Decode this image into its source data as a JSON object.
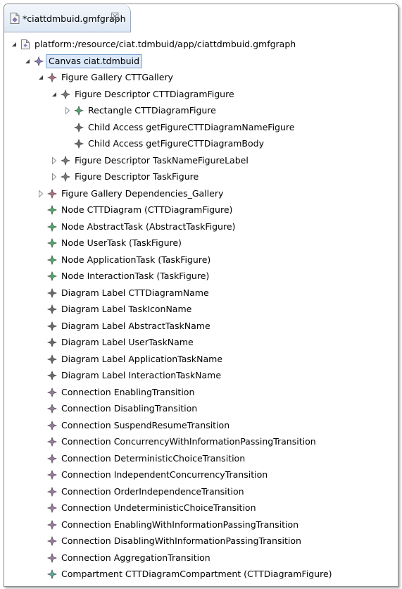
{
  "editor": {
    "tab_title": "*ciattdmbuid.gmfgraph",
    "tab_close_glyph": "☒"
  },
  "tree": {
    "rows": [
      {
        "label": "platform:/resource/ciat.tdmbuid/app/ciattdmbuid.gmfgraph",
        "depth": 0,
        "twisty": "expanded",
        "icon": "resource-file-icon",
        "color": "#7a7a7a"
      },
      {
        "label": "Canvas ciat.tdmbuid",
        "depth": 1,
        "twisty": "expanded",
        "icon": "canvas-icon",
        "color": "#8a7fb8",
        "selected": true
      },
      {
        "label": "Figure Gallery CTTGallery",
        "depth": 2,
        "twisty": "expanded",
        "icon": "figure-gallery-icon",
        "color": "#b0707e"
      },
      {
        "label": "Figure Descriptor CTTDiagramFigure",
        "depth": 3,
        "twisty": "expanded",
        "icon": "figure-descriptor-icon",
        "color": "#7a7a7a"
      },
      {
        "label": "Rectangle CTTDiagramFigure",
        "depth": 4,
        "twisty": "collapsed",
        "icon": "rectangle-icon",
        "color": "#4fa86a"
      },
      {
        "label": "Child Access getFigureCTTDiagramNameFigure",
        "depth": 4,
        "twisty": "none",
        "icon": "child-access-icon",
        "color": "#6a6a6a"
      },
      {
        "label": "Child Access getFigureCTTDiagramBody",
        "depth": 4,
        "twisty": "none",
        "icon": "child-access-icon",
        "color": "#6a6a6a"
      },
      {
        "label": "Figure Descriptor TaskNameFigureLabel",
        "depth": 3,
        "twisty": "collapsed",
        "icon": "figure-descriptor-icon",
        "color": "#7a7a7a"
      },
      {
        "label": "Figure Descriptor TaskFigure",
        "depth": 3,
        "twisty": "collapsed",
        "icon": "figure-descriptor-icon",
        "color": "#7a7a7a"
      },
      {
        "label": "Figure Gallery Dependencies_Gallery",
        "depth": 2,
        "twisty": "collapsed",
        "icon": "figure-gallery-icon",
        "color": "#b0707e"
      },
      {
        "label": "Node CTTDiagram (CTTDiagramFigure)",
        "depth": 2,
        "twisty": "none",
        "icon": "node-icon",
        "color": "#4fa86a"
      },
      {
        "label": "Node AbstractTask (AbstractTaskFigure)",
        "depth": 2,
        "twisty": "none",
        "icon": "node-icon",
        "color": "#4fa86a"
      },
      {
        "label": "Node UserTask (TaskFigure)",
        "depth": 2,
        "twisty": "none",
        "icon": "node-icon",
        "color": "#4fa86a"
      },
      {
        "label": "Node ApplicationTask (TaskFigure)",
        "depth": 2,
        "twisty": "none",
        "icon": "node-icon",
        "color": "#4fa86a"
      },
      {
        "label": "Node InteractionTask (TaskFigure)",
        "depth": 2,
        "twisty": "none",
        "icon": "node-icon",
        "color": "#4fa86a"
      },
      {
        "label": "Diagram Label CTTDiagramName",
        "depth": 2,
        "twisty": "none",
        "icon": "diagram-label-icon",
        "color": "#6a6a6a"
      },
      {
        "label": "Diagram Label TaskIconName",
        "depth": 2,
        "twisty": "none",
        "icon": "diagram-label-icon",
        "color": "#6a6a6a"
      },
      {
        "label": "Diagram Label AbstractTaskName",
        "depth": 2,
        "twisty": "none",
        "icon": "diagram-label-icon",
        "color": "#6a6a6a"
      },
      {
        "label": "Diagram Label UserTaskName",
        "depth": 2,
        "twisty": "none",
        "icon": "diagram-label-icon",
        "color": "#6a6a6a"
      },
      {
        "label": "Diagram Label ApplicationTaskName",
        "depth": 2,
        "twisty": "none",
        "icon": "diagram-label-icon",
        "color": "#6a6a6a"
      },
      {
        "label": "Diagram Label InteractionTaskName",
        "depth": 2,
        "twisty": "none",
        "icon": "diagram-label-icon",
        "color": "#6a6a6a"
      },
      {
        "label": "Connection EnablingTransition",
        "depth": 2,
        "twisty": "none",
        "icon": "connection-icon",
        "color": "#9a7aa0"
      },
      {
        "label": "Connection DisablingTransition",
        "depth": 2,
        "twisty": "none",
        "icon": "connection-icon",
        "color": "#9a7aa0"
      },
      {
        "label": "Connection SuspendResumeTransition",
        "depth": 2,
        "twisty": "none",
        "icon": "connection-icon",
        "color": "#9a7aa0"
      },
      {
        "label": "Connection ConcurrencyWithInformationPassingTransition",
        "depth": 2,
        "twisty": "none",
        "icon": "connection-icon",
        "color": "#9a7aa0"
      },
      {
        "label": "Connection DeterministicChoiceTransition",
        "depth": 2,
        "twisty": "none",
        "icon": "connection-icon",
        "color": "#9a7aa0"
      },
      {
        "label": "Connection IndependentConcurrencyTransition",
        "depth": 2,
        "twisty": "none",
        "icon": "connection-icon",
        "color": "#9a7aa0"
      },
      {
        "label": "Connection OrderIndependenceTransition",
        "depth": 2,
        "twisty": "none",
        "icon": "connection-icon",
        "color": "#9a7aa0"
      },
      {
        "label": "Connection UndeterministicChoiceTransition",
        "depth": 2,
        "twisty": "none",
        "icon": "connection-icon",
        "color": "#9a7aa0"
      },
      {
        "label": "Connection EnablingWithInformationPassingTransition",
        "depth": 2,
        "twisty": "none",
        "icon": "connection-icon",
        "color": "#9a7aa0"
      },
      {
        "label": "Connection DisablingWithInformationPassingTransition",
        "depth": 2,
        "twisty": "none",
        "icon": "connection-icon",
        "color": "#9a7aa0"
      },
      {
        "label": "Connection AggregationTransition",
        "depth": 2,
        "twisty": "none",
        "icon": "connection-icon",
        "color": "#9a7aa0"
      },
      {
        "label": "Compartment CTTDiagramCompartment (CTTDiagramFigure)",
        "depth": 2,
        "twisty": "none",
        "icon": "compartment-icon",
        "color": "#5aa89a"
      }
    ]
  }
}
